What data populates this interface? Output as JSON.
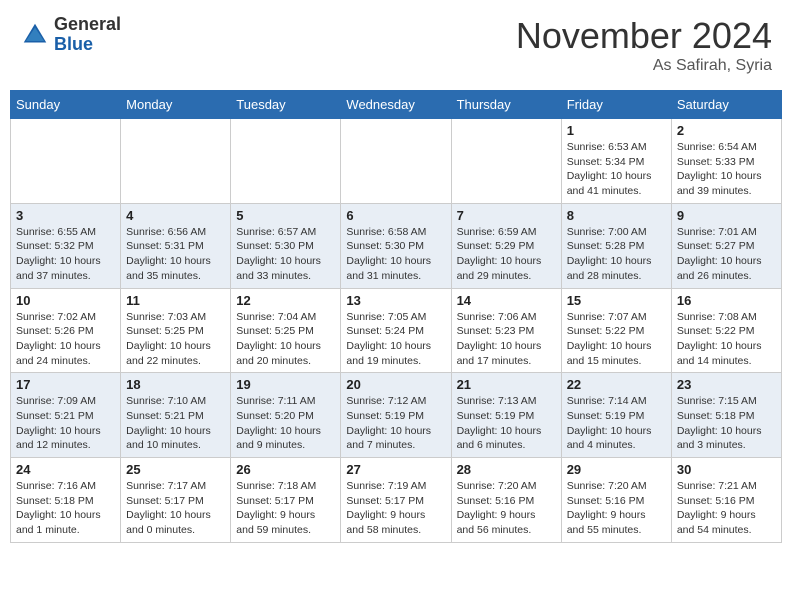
{
  "header": {
    "logo_general": "General",
    "logo_blue": "Blue",
    "month_title": "November 2024",
    "subtitle": "As Safirah, Syria"
  },
  "weekdays": [
    "Sunday",
    "Monday",
    "Tuesday",
    "Wednesday",
    "Thursday",
    "Friday",
    "Saturday"
  ],
  "weeks": [
    [
      {
        "day": "",
        "info": ""
      },
      {
        "day": "",
        "info": ""
      },
      {
        "day": "",
        "info": ""
      },
      {
        "day": "",
        "info": ""
      },
      {
        "day": "",
        "info": ""
      },
      {
        "day": "1",
        "info": "Sunrise: 6:53 AM\nSunset: 5:34 PM\nDaylight: 10 hours and 41 minutes."
      },
      {
        "day": "2",
        "info": "Sunrise: 6:54 AM\nSunset: 5:33 PM\nDaylight: 10 hours and 39 minutes."
      }
    ],
    [
      {
        "day": "3",
        "info": "Sunrise: 6:55 AM\nSunset: 5:32 PM\nDaylight: 10 hours and 37 minutes."
      },
      {
        "day": "4",
        "info": "Sunrise: 6:56 AM\nSunset: 5:31 PM\nDaylight: 10 hours and 35 minutes."
      },
      {
        "day": "5",
        "info": "Sunrise: 6:57 AM\nSunset: 5:30 PM\nDaylight: 10 hours and 33 minutes."
      },
      {
        "day": "6",
        "info": "Sunrise: 6:58 AM\nSunset: 5:30 PM\nDaylight: 10 hours and 31 minutes."
      },
      {
        "day": "7",
        "info": "Sunrise: 6:59 AM\nSunset: 5:29 PM\nDaylight: 10 hours and 29 minutes."
      },
      {
        "day": "8",
        "info": "Sunrise: 7:00 AM\nSunset: 5:28 PM\nDaylight: 10 hours and 28 minutes."
      },
      {
        "day": "9",
        "info": "Sunrise: 7:01 AM\nSunset: 5:27 PM\nDaylight: 10 hours and 26 minutes."
      }
    ],
    [
      {
        "day": "10",
        "info": "Sunrise: 7:02 AM\nSunset: 5:26 PM\nDaylight: 10 hours and 24 minutes."
      },
      {
        "day": "11",
        "info": "Sunrise: 7:03 AM\nSunset: 5:25 PM\nDaylight: 10 hours and 22 minutes."
      },
      {
        "day": "12",
        "info": "Sunrise: 7:04 AM\nSunset: 5:25 PM\nDaylight: 10 hours and 20 minutes."
      },
      {
        "day": "13",
        "info": "Sunrise: 7:05 AM\nSunset: 5:24 PM\nDaylight: 10 hours and 19 minutes."
      },
      {
        "day": "14",
        "info": "Sunrise: 7:06 AM\nSunset: 5:23 PM\nDaylight: 10 hours and 17 minutes."
      },
      {
        "day": "15",
        "info": "Sunrise: 7:07 AM\nSunset: 5:22 PM\nDaylight: 10 hours and 15 minutes."
      },
      {
        "day": "16",
        "info": "Sunrise: 7:08 AM\nSunset: 5:22 PM\nDaylight: 10 hours and 14 minutes."
      }
    ],
    [
      {
        "day": "17",
        "info": "Sunrise: 7:09 AM\nSunset: 5:21 PM\nDaylight: 10 hours and 12 minutes."
      },
      {
        "day": "18",
        "info": "Sunrise: 7:10 AM\nSunset: 5:21 PM\nDaylight: 10 hours and 10 minutes."
      },
      {
        "day": "19",
        "info": "Sunrise: 7:11 AM\nSunset: 5:20 PM\nDaylight: 10 hours and 9 minutes."
      },
      {
        "day": "20",
        "info": "Sunrise: 7:12 AM\nSunset: 5:19 PM\nDaylight: 10 hours and 7 minutes."
      },
      {
        "day": "21",
        "info": "Sunrise: 7:13 AM\nSunset: 5:19 PM\nDaylight: 10 hours and 6 minutes."
      },
      {
        "day": "22",
        "info": "Sunrise: 7:14 AM\nSunset: 5:19 PM\nDaylight: 10 hours and 4 minutes."
      },
      {
        "day": "23",
        "info": "Sunrise: 7:15 AM\nSunset: 5:18 PM\nDaylight: 10 hours and 3 minutes."
      }
    ],
    [
      {
        "day": "24",
        "info": "Sunrise: 7:16 AM\nSunset: 5:18 PM\nDaylight: 10 hours and 1 minute."
      },
      {
        "day": "25",
        "info": "Sunrise: 7:17 AM\nSunset: 5:17 PM\nDaylight: 10 hours and 0 minutes."
      },
      {
        "day": "26",
        "info": "Sunrise: 7:18 AM\nSunset: 5:17 PM\nDaylight: 9 hours and 59 minutes."
      },
      {
        "day": "27",
        "info": "Sunrise: 7:19 AM\nSunset: 5:17 PM\nDaylight: 9 hours and 58 minutes."
      },
      {
        "day": "28",
        "info": "Sunrise: 7:20 AM\nSunset: 5:16 PM\nDaylight: 9 hours and 56 minutes."
      },
      {
        "day": "29",
        "info": "Sunrise: 7:20 AM\nSunset: 5:16 PM\nDaylight: 9 hours and 55 minutes."
      },
      {
        "day": "30",
        "info": "Sunrise: 7:21 AM\nSunset: 5:16 PM\nDaylight: 9 hours and 54 minutes."
      }
    ]
  ]
}
